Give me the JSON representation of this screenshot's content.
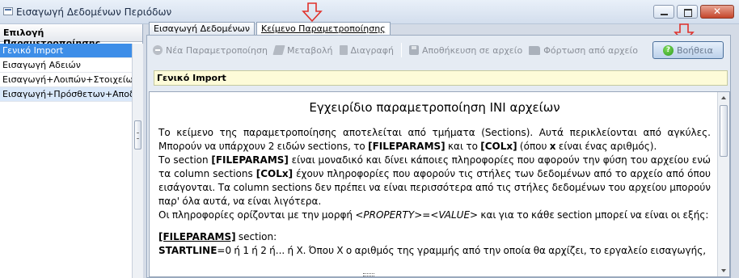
{
  "window": {
    "title": "Εισαγωγή Δεδομένων Περιόδων",
    "controls": [
      "minimize",
      "maximize",
      "close"
    ]
  },
  "left_panel": {
    "header": "Επιλογή Παραμετροποίησης",
    "items": [
      {
        "label": "Γενικό Import",
        "state": "selected"
      },
      {
        "label": "Εισαγωγή Αδειών",
        "state": "normal"
      },
      {
        "label": "Εισαγωγή+Λοιπών+Στοιχείων",
        "state": "normal"
      },
      {
        "label": "Εισαγωγή+Πρόσθετων+Αποδοχών",
        "state": "highlight"
      }
    ]
  },
  "tabs": [
    {
      "label": "Εισαγωγή Δεδομένων",
      "active": false
    },
    {
      "label": "Κείμενο Παραμετροποίησης",
      "active": true
    }
  ],
  "toolbar": {
    "new_label": "Νέα Παραμετροποίηση",
    "edit_label": "Μεταβολή",
    "delete_label": "Διαγραφή",
    "save_file_label": "Αποθήκευση σε αρχείο",
    "load_file_label": "Φόρτωση από αρχείο",
    "help_label": "Βοήθεια"
  },
  "selected_param": "Γενικό Import",
  "doc": {
    "title": "Εγχειρίδιο παραμετροποίηση INI αρχείων",
    "p1_a": "Το κείμενο της παραμετροποίησης αποτελείται από τμήματα (Sections). Αυτά περικλείονται από αγκύλες. Μπορούν να υπάρχουν 2 ειδών sections, το ",
    "p1_b1": "[FILEPARAMS]",
    "p1_c": " και το ",
    "p1_b2": "[COLx]",
    "p1_d": " (όπου ",
    "p1_b3": "x",
    "p1_e": " είναι ένας αριθμός).",
    "p2_a": "Το section ",
    "p2_b1": "[FILEPARAMS]",
    "p2_c": " είναι μοναδικό και δίνει κάποιες πληροφορίες που αφορούν την φύση του αρχείου ενώ τα column sections ",
    "p2_b2": "[COLx]",
    "p2_d": " έχουν πληροφορίες που αφορούν τις στήλες των δεδομένων από το αρχείο από όπου εισάγονται. Τα column sections δεν πρέπει να είναι περισσότερα από τις στήλες δεδομένων του αρχείου μπορούν παρ' όλα αυτά, να είναι λιγότερα.",
    "p3_a": "Οι πληροφορίες ορίζονται με την μορφή ",
    "p3_i": "<PROPERTY>=<VALUE>",
    "p3_b": " και για το κάθε section μπορεί να είναι οι εξής:",
    "sec_name": "[FILEPARAMS]",
    "sec_suffix": " section:",
    "p4_b": "STARTLINE",
    "p4_a": "=0 ή 1 ή 2 ή... ή X. Όπου X ο αριθμός της γραμμής από την οποία θα αρχίζει, το εργαλείο εισαγωγής,"
  },
  "annotation_color": "#e0302a",
  "accent_selection": "#3d8ee8",
  "param_field_bg": "#fdfbd8"
}
